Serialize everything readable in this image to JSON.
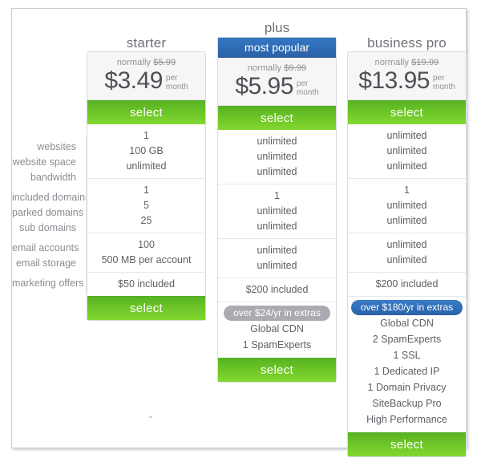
{
  "feature_groups": [
    {
      "labels": [
        "websites",
        "website space",
        "bandwidth"
      ]
    },
    {
      "labels": [
        "included domains",
        "parked domains",
        "sub domains"
      ]
    },
    {
      "labels": [
        "email accounts",
        "email storage"
      ]
    },
    {
      "labels": [
        "marketing offers"
      ]
    }
  ],
  "colors": {
    "blue": "#2a62a8",
    "green": "#6cc427",
    "grey_pill": "#a9abb0",
    "text": "#5d6065",
    "label_text": "#8a8d93",
    "card_border": "#d9dade",
    "price_bg": "#f6f6f6"
  },
  "plans": [
    {
      "name": "starter",
      "ribbon": null,
      "normally_prefix": "normally",
      "normally_price": "$5.99",
      "price": "$3.49",
      "per": "per",
      "month": "month",
      "select_top": "select",
      "select_bottom": "select",
      "groups": [
        {
          "values": [
            "1",
            "100 GB",
            "unlimited"
          ]
        },
        {
          "values": [
            "1",
            "5",
            "25"
          ]
        },
        {
          "values": [
            "100",
            "500 MB per account"
          ]
        },
        {
          "values": [
            "$50 included"
          ]
        }
      ],
      "extras_pill": null,
      "extras": []
    },
    {
      "name": "plus",
      "ribbon": "most popular",
      "normally_prefix": "normally",
      "normally_price": "$9.99",
      "price": "$5.95",
      "per": "per",
      "month": "month",
      "select_top": "select",
      "select_bottom": "select",
      "groups": [
        {
          "values": [
            "unlimited",
            "unlimited",
            "unlimited"
          ]
        },
        {
          "values": [
            "1",
            "unlimited",
            "unlimited"
          ]
        },
        {
          "values": [
            "unlimited",
            "unlimited"
          ]
        },
        {
          "values": [
            "$200 included"
          ]
        }
      ],
      "extras_pill": "over $24/yr in extras",
      "extras": [
        "Global CDN",
        "1 SpamExperts"
      ]
    },
    {
      "name": "business pro",
      "ribbon": null,
      "normally_prefix": "normally",
      "normally_price": "$19.99",
      "price": "$13.95",
      "per": "per",
      "month": "month",
      "select_top": "select",
      "select_bottom": "select",
      "groups": [
        {
          "values": [
            "unlimited",
            "unlimited",
            "unlimited"
          ]
        },
        {
          "values": [
            "1",
            "unlimited",
            "unlimited"
          ]
        },
        {
          "values": [
            "unlimited",
            "unlimited"
          ]
        },
        {
          "values": [
            "$200 included"
          ]
        }
      ],
      "extras_pill": "over $180/yr in extras",
      "extras": [
        "Global CDN",
        "2 SpamExperts",
        "1 SSL",
        "1 Dedicated IP",
        "1 Domain Privacy",
        "SiteBackup Pro",
        "High Performance"
      ]
    }
  ]
}
